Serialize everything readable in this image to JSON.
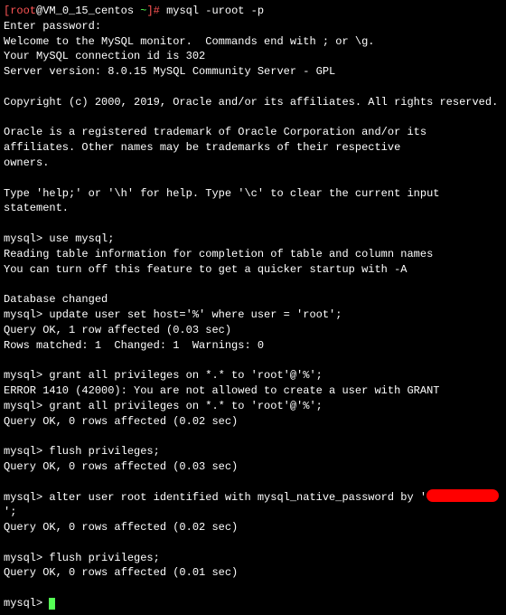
{
  "prompt": {
    "user": "root",
    "host": "VM_0_15_centos",
    "path": "~",
    "symbol": "#",
    "command": "mysql -uroot -p"
  },
  "lines": {
    "enter_password": "Enter password:",
    "welcome": "Welcome to the MySQL monitor.  Commands end with ; or \\g.",
    "connection_id": "Your MySQL connection id is 302",
    "server_version": "Server version: 8.0.15 MySQL Community Server - GPL",
    "copyright": "Copyright (c) 2000, 2019, Oracle and/or its affiliates. All rights reserved.",
    "trademark1": "Oracle is a registered trademark of Oracle Corporation and/or its",
    "trademark2": "affiliates. Other names may be trademarks of their respective",
    "trademark3": "owners.",
    "help": "Type 'help;' or '\\h' for help. Type '\\c' to clear the current input statement.",
    "use_mysql": "mysql> use mysql;",
    "reading": "Reading table information for completion of table and column names",
    "turn_off": "You can turn off this feature to get a quicker startup with -A",
    "db_changed": "Database changed",
    "update": "mysql> update user set host='%' where user = 'root';",
    "query_ok_1row": "Query OK, 1 row affected (0.03 sec)",
    "rows_matched": "Rows matched: 1  Changed: 1  Warnings: 0",
    "grant1": "mysql> grant all privileges on *.* to 'root'@'%';",
    "error1410": "ERROR 1410 (42000): You are not allowed to create a user with GRANT",
    "grant2": "mysql> grant all privileges on *.* to 'root'@'%';",
    "query_ok_0_002": "Query OK, 0 rows affected (0.02 sec)",
    "flush1": "mysql> flush privileges;",
    "query_ok_0_003": "Query OK, 0 rows affected (0.03 sec)",
    "alter_prefix": "mysql> alter user root identified with mysql_native_password by '",
    "alter_suffix": "';",
    "query_ok_0_002b": "Query OK, 0 rows affected (0.02 sec)",
    "flush2": "mysql> flush privileges;",
    "query_ok_0_001": "Query OK, 0 rows affected (0.01 sec)",
    "final_prompt": "mysql> "
  }
}
